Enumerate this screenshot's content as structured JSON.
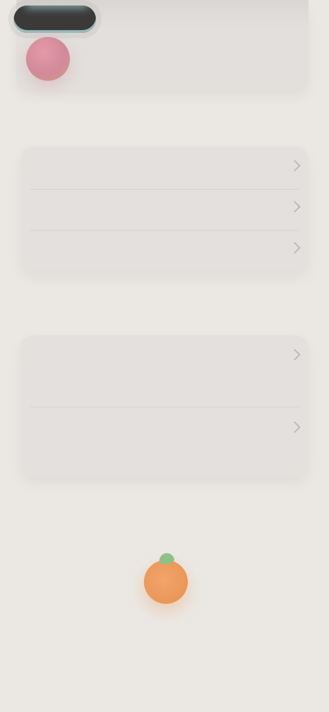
{
  "profile": {
    "name": "",
    "subtitle": ""
  },
  "sections": [
    {
      "label": "",
      "rows": [
        {
          "label": "",
          "value": ""
        },
        {
          "label": "",
          "value": ""
        },
        {
          "label": "",
          "value": ""
        }
      ]
    },
    {
      "label": "",
      "rows": [
        {
          "label": "",
          "description": ""
        },
        {
          "label": "",
          "description": ""
        }
      ]
    }
  ],
  "footer": {
    "text": ""
  },
  "colors": {
    "background": "#ebe8e4",
    "card": "#e3e0dd",
    "avatar": "#e59aa8",
    "fruit": "#eb995b",
    "leaf": "#8fc186",
    "top_pill": "#3b3a39",
    "top_pill_accent": "#8fb3b2"
  },
  "icons": {
    "chevron": "chevron-right-icon",
    "logo": "orange-fruit-icon"
  }
}
